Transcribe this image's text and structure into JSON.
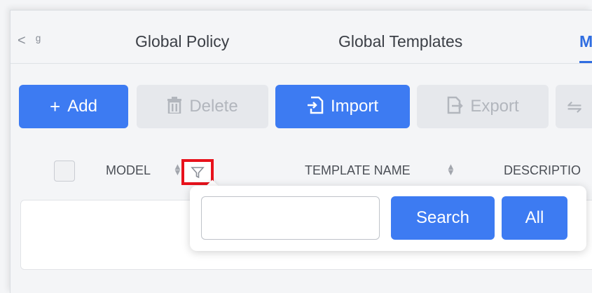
{
  "tabs": {
    "scroll_left": "<",
    "truncated_glyph": "̥",
    "items": [
      {
        "label": "Global Policy"
      },
      {
        "label": "Global Templates"
      },
      {
        "label": "M"
      }
    ]
  },
  "toolbar": {
    "add_label": "Add",
    "delete_label": "Delete",
    "import_label": "Import",
    "export_label": "Export"
  },
  "table": {
    "columns": [
      {
        "label": "MODEL"
      },
      {
        "label": "TEMPLATE NAME"
      },
      {
        "label": "DESCRIPTIO"
      }
    ]
  },
  "filter_popover": {
    "input_value": "",
    "search_label": "Search",
    "all_label": "All"
  },
  "colors": {
    "primary": "#3d7bf2",
    "highlight": "#e8121c",
    "active_tab": "#2f6de1"
  }
}
